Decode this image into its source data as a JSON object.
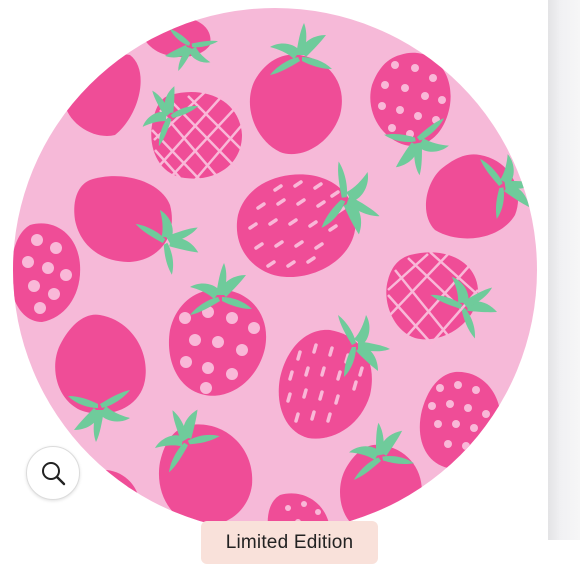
{
  "product_image": {
    "pattern": "strawberries",
    "background_color": "#f6b9d8",
    "berry_color": "#ef4d97",
    "seed_color": "#f9b8d8",
    "leaf_color": "#6fcb9b"
  },
  "zoom_button": {
    "icon": "zoom-icon"
  },
  "badge": {
    "label": "Limited Edition",
    "color": "#f9e1da"
  }
}
